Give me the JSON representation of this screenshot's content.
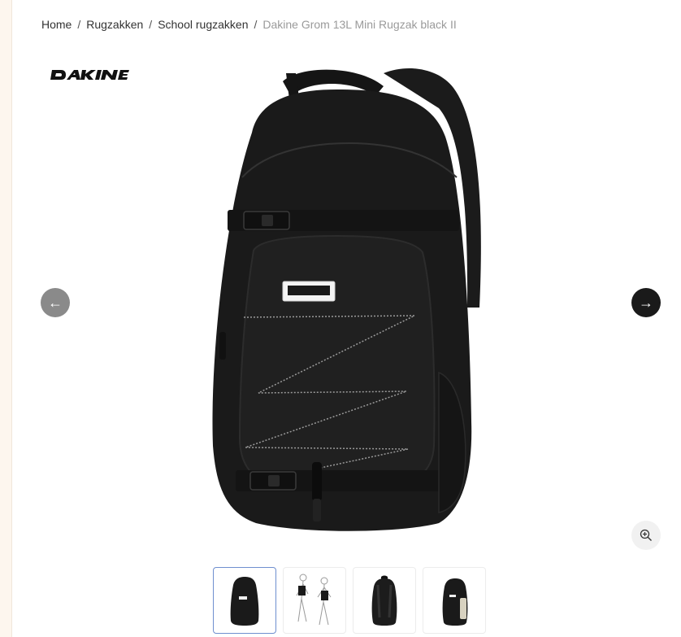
{
  "breadcrumb": {
    "items": [
      {
        "label": "Home"
      },
      {
        "label": "Rugzakken"
      },
      {
        "label": "School rugzakken"
      }
    ],
    "separator": "/",
    "current": "Dakine Grom 13L Mini Rugzak black II"
  },
  "brand": {
    "name": "DAKINE"
  },
  "gallery": {
    "prev_icon": "arrow-left-icon",
    "next_icon": "arrow-right-icon",
    "zoom_icon": "zoom-in-icon",
    "thumbnails": [
      {
        "name": "thumbnail-backpack-front",
        "active": true
      },
      {
        "name": "thumbnail-backpack-worn-sketch",
        "active": false
      },
      {
        "name": "thumbnail-backpack-back",
        "active": false
      },
      {
        "name": "thumbnail-backpack-side",
        "active": false
      }
    ]
  },
  "colors": {
    "background": "#fdf6ee",
    "active_thumb_border": "#6f8fcf",
    "next_button": "#1a1a1a",
    "prev_button": "#8a8a8a"
  }
}
